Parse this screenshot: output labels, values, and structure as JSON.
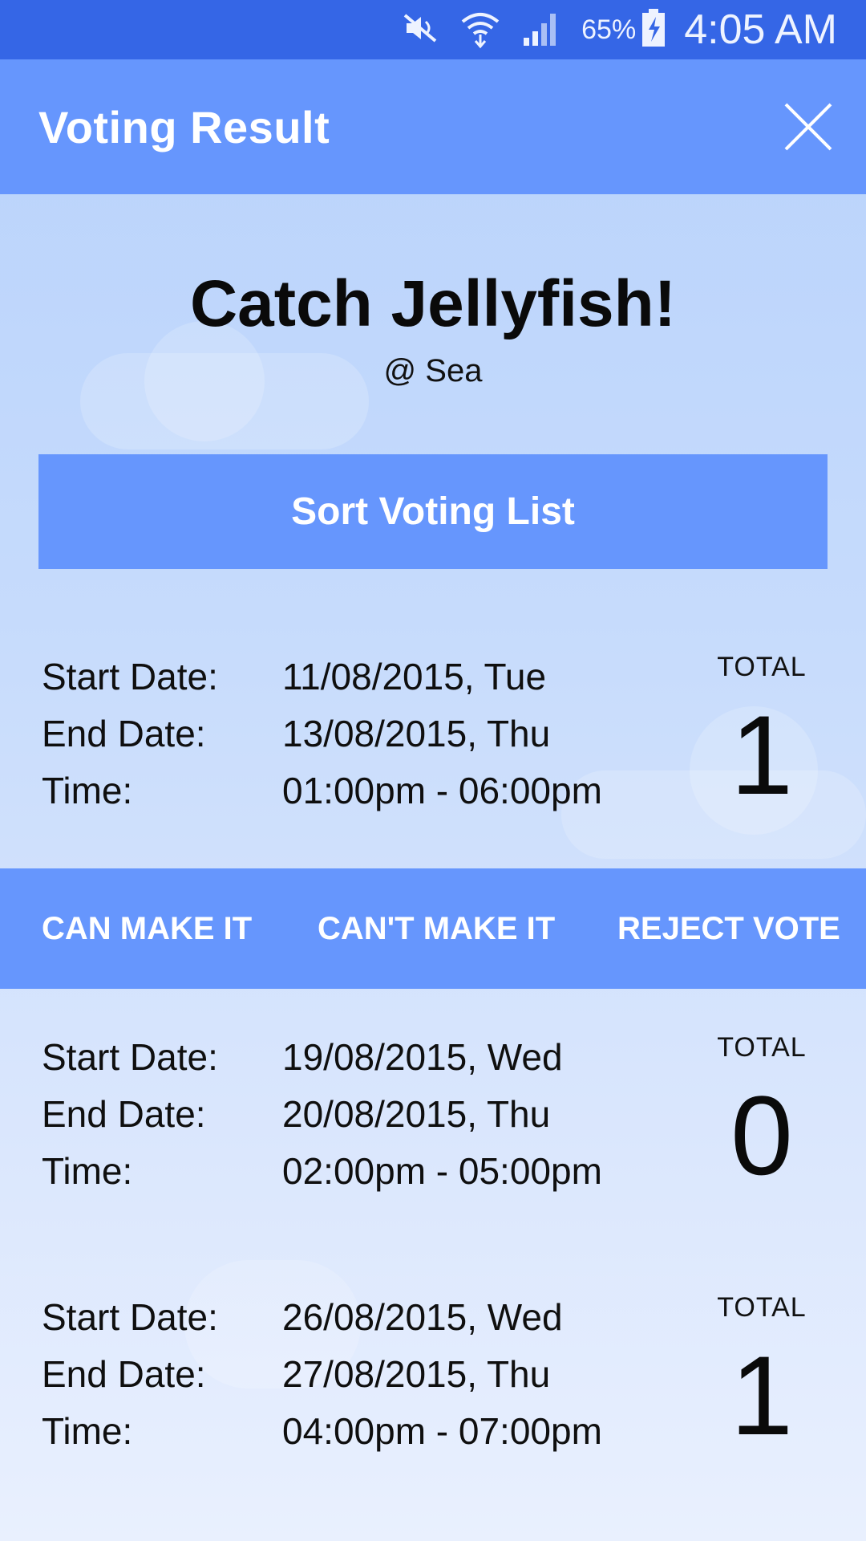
{
  "status_bar": {
    "battery_percent": "65%",
    "clock": "4:05 AM",
    "icons": [
      "mute-icon",
      "wifi-icon",
      "signal-icon",
      "battery-charging-icon"
    ]
  },
  "app_bar": {
    "title": "Voting Result",
    "close_icon": "close-icon"
  },
  "event": {
    "title": "Catch Jellyfish!",
    "location": "@ Sea"
  },
  "sort_button": "Sort Voting List",
  "labels": {
    "start": "Start Date:",
    "end": "End Date:",
    "time": "Time:",
    "total": "TOTAL"
  },
  "options": [
    {
      "start": "11/08/2015, Tue",
      "end": "13/08/2015, Thu",
      "time": "01:00pm - 06:00pm",
      "total": "1"
    },
    {
      "start": "19/08/2015, Wed",
      "end": "20/08/2015, Thu",
      "time": "02:00pm - 05:00pm",
      "total": "0"
    },
    {
      "start": "26/08/2015, Wed",
      "end": "27/08/2015, Thu",
      "time": "04:00pm - 07:00pm",
      "total": "1"
    }
  ],
  "actions": {
    "can": "CAN MAKE IT",
    "cant": "CAN'T MAKE IT",
    "reject": "REJECT VOTE"
  },
  "colors": {
    "status_bar": "#3566e6",
    "accent": "#6696fd",
    "background_top": "#b8d2fb",
    "background_bottom": "#e9f0fe"
  }
}
